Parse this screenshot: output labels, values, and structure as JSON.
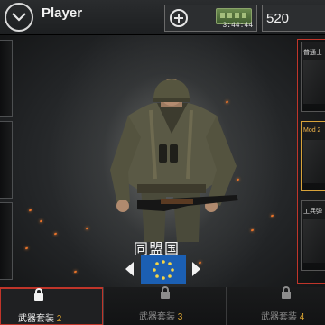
{
  "header": {
    "title": "Player",
    "supply_timer": "3:44:44",
    "currency_value": "520"
  },
  "right_cards": [
    {
      "label": "普通士"
    },
    {
      "label": "Mod 2"
    },
    {
      "label": "工兵弹"
    }
  ],
  "faction": {
    "name": "同盟国"
  },
  "tabs": [
    {
      "label": "武器套装",
      "number": "2",
      "state": "selected"
    },
    {
      "label": "武器套装",
      "number": "3",
      "state": "locked"
    },
    {
      "label": "武器套装",
      "number": "4",
      "state": "locked"
    }
  ],
  "colors": {
    "accent_red": "#c0352a",
    "tab_number_gold": "#e0a832",
    "flag_blue": "#1b5fb3",
    "flag_stars": "#f5d547"
  },
  "icons": [
    "chevron-down-icon",
    "plus-icon",
    "supply-crate-icon",
    "lock-icon",
    "arrow-left-icon",
    "arrow-right-icon",
    "flag-icon"
  ]
}
